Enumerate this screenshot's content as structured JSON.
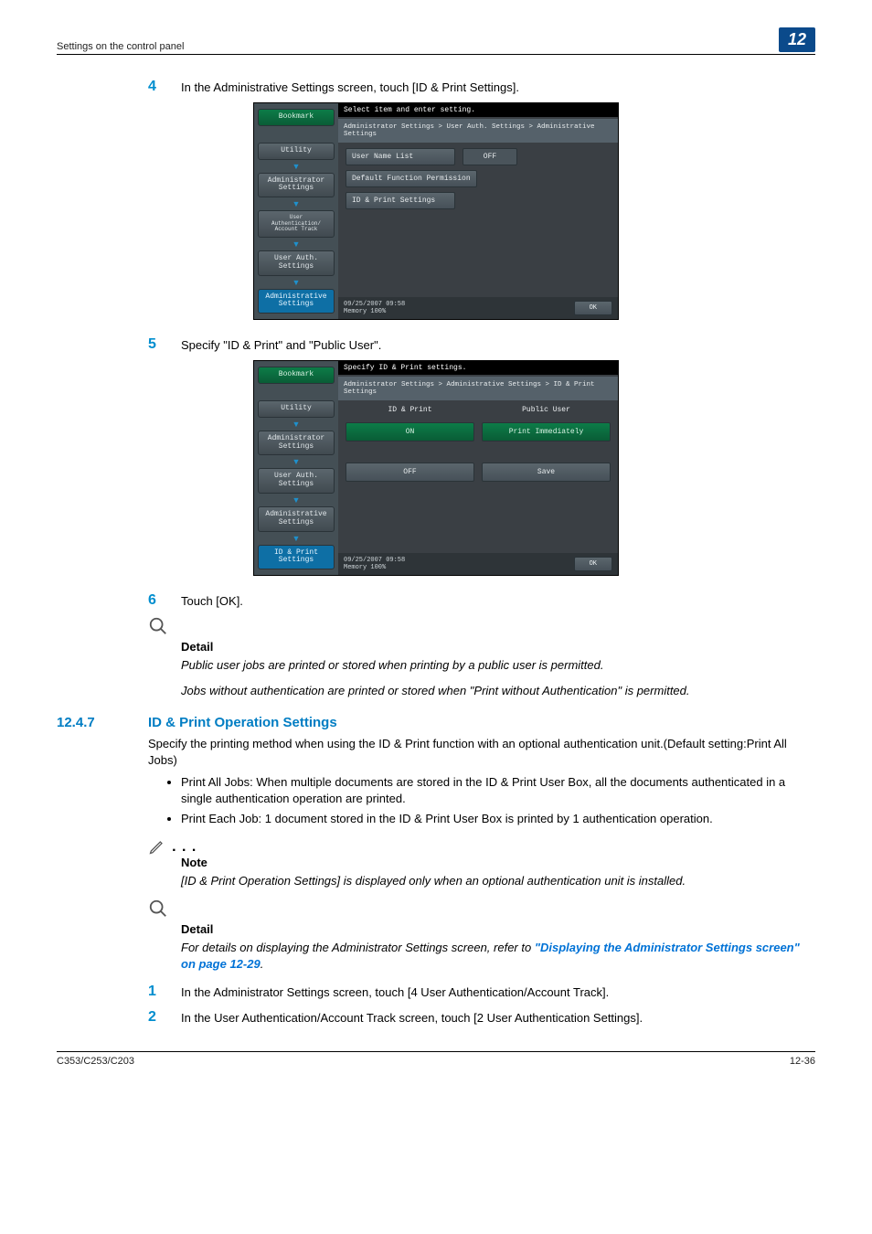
{
  "header": {
    "left": "Settings on the control panel",
    "chapter": "12"
  },
  "step4": {
    "num": "4",
    "text": "In the Administrative Settings screen, touch [ID & Print Settings]."
  },
  "panel1": {
    "top": "Select item and enter setting.",
    "crumb": "Administrator Settings > User Auth. Settings > Administrative Settings",
    "left": {
      "bookmark": "Bookmark",
      "utility": "Utility",
      "admin": "Administrator\nSettings",
      "userauthacct": "User\nAuthentication/\nAccount Track",
      "userauth": "User Auth.\nSettings",
      "adminset": "Administrative\nSettings"
    },
    "body": {
      "userNameList": "User Name List",
      "off": "OFF",
      "defFunc": "Default Function Permission",
      "idprint": "ID & Print Settings"
    },
    "foot": {
      "dt": "09/25/2007   09:58",
      "mem": "Memory        100%",
      "ok": "OK"
    }
  },
  "step5": {
    "num": "5",
    "text": "Specify \"ID & Print\" and \"Public User\"."
  },
  "panel2": {
    "top": "Specify ID & Print settings.",
    "crumb": "Administrator Settings > Administrative Settings > ID & Print Settings",
    "left": {
      "bookmark": "Bookmark",
      "utility": "Utility",
      "admin": "Administrator\nSettings",
      "userauth": "User Auth.\nSettings",
      "adminset": "Administrative\nSettings",
      "idprint": "ID & Print\nSettings"
    },
    "cols": {
      "left": "ID & Print",
      "right": "Public User"
    },
    "body": {
      "on": "ON",
      "printImm": "Print Immediately",
      "off": "OFF",
      "save": "Save"
    },
    "foot": {
      "dt": "09/25/2007   09:58",
      "mem": "Memory        100%",
      "ok": "OK"
    }
  },
  "step6": {
    "num": "6",
    "text": "Touch [OK]."
  },
  "detail1": {
    "label": "Detail",
    "l1": "Public user jobs are printed or stored when printing by a public user is permitted.",
    "l2": "Jobs without authentication are printed or stored when \"Print without Authentication\" is permitted."
  },
  "section": {
    "num": "12.4.7",
    "title": "ID & Print Operation Settings",
    "para": "Specify the printing method when using the ID & Print function with an optional authentication unit.(Default setting:Print All Jobs)",
    "b1": "Print All Jobs: When multiple documents are stored in the ID & Print User Box, all the documents authenticated in a single authentication operation are printed.",
    "b2": "Print Each Job: 1 document stored in the ID & Print User Box is printed by 1 authentication operation."
  },
  "note": {
    "label": "Note",
    "text": "[ID & Print Operation Settings] is displayed only when an optional authentication unit is installed."
  },
  "detail2": {
    "label": "Detail",
    "pre": "For details on displaying the Administrator Settings screen, refer to ",
    "link": "\"Displaying the Administrator Settings screen\" on page 12-29",
    "post": "."
  },
  "step1": {
    "num": "1",
    "text": "In the Administrator Settings screen, touch [4 User Authentication/Account Track]."
  },
  "step2": {
    "num": "2",
    "text": "In the User Authentication/Account Track screen, touch [2 User Authentication Settings]."
  },
  "footer": {
    "left": "C353/C253/C203",
    "right": "12-36"
  }
}
